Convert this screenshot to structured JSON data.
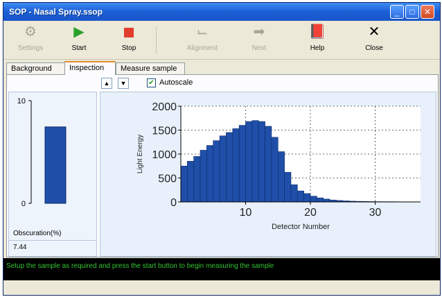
{
  "window": {
    "title": "SOP - Nasal Spray.ssop"
  },
  "toolbar": {
    "settings": "Settings",
    "start": "Start",
    "stop": "Stop",
    "alignment": "Alignment",
    "next": "Next",
    "help": "Help",
    "close": "Close"
  },
  "tabs": [
    {
      "label": "Background"
    },
    {
      "label": "Inspection"
    },
    {
      "label": "Measure sample"
    }
  ],
  "controls": {
    "autoscale_label": "Autoscale",
    "autoscale_checked": true
  },
  "obscuration": {
    "label": "Obscuration(%)",
    "value": "7.44",
    "bar_value": 7.44,
    "axis_max": 10,
    "axis_min": 0,
    "ticks": [
      "10",
      "0"
    ]
  },
  "status": {
    "message": "Setup the sample as required and press the start button to begin measuring the sample"
  },
  "colors": {
    "bar": "#1f4fa8",
    "bar_edge": "#0b2a6a",
    "titlebar": "#1b5fd6",
    "status_text": "#36c436"
  },
  "chart_data": {
    "type": "bar",
    "xlabel": "Detector Number",
    "ylabel": "Light Energy",
    "xlim": [
      0,
      37
    ],
    "ylim": [
      0,
      2000
    ],
    "xticks": [
      10,
      20,
      30
    ],
    "yticks": [
      0,
      500,
      1000,
      1500,
      2000
    ],
    "grid": true,
    "x": [
      1,
      2,
      3,
      4,
      5,
      6,
      7,
      8,
      9,
      10,
      11,
      12,
      13,
      14,
      15,
      16,
      17,
      18,
      19,
      20,
      21,
      22,
      23,
      24,
      25,
      26,
      27,
      28,
      29,
      30,
      31,
      32,
      33,
      34,
      35,
      36
    ],
    "values": [
      750,
      850,
      950,
      1080,
      1180,
      1280,
      1380,
      1450,
      1530,
      1600,
      1680,
      1700,
      1680,
      1580,
      1350,
      1050,
      620,
      360,
      230,
      175,
      120,
      85,
      60,
      40,
      30,
      22,
      16,
      12,
      10,
      8,
      6,
      5,
      5,
      4,
      3,
      3
    ]
  }
}
